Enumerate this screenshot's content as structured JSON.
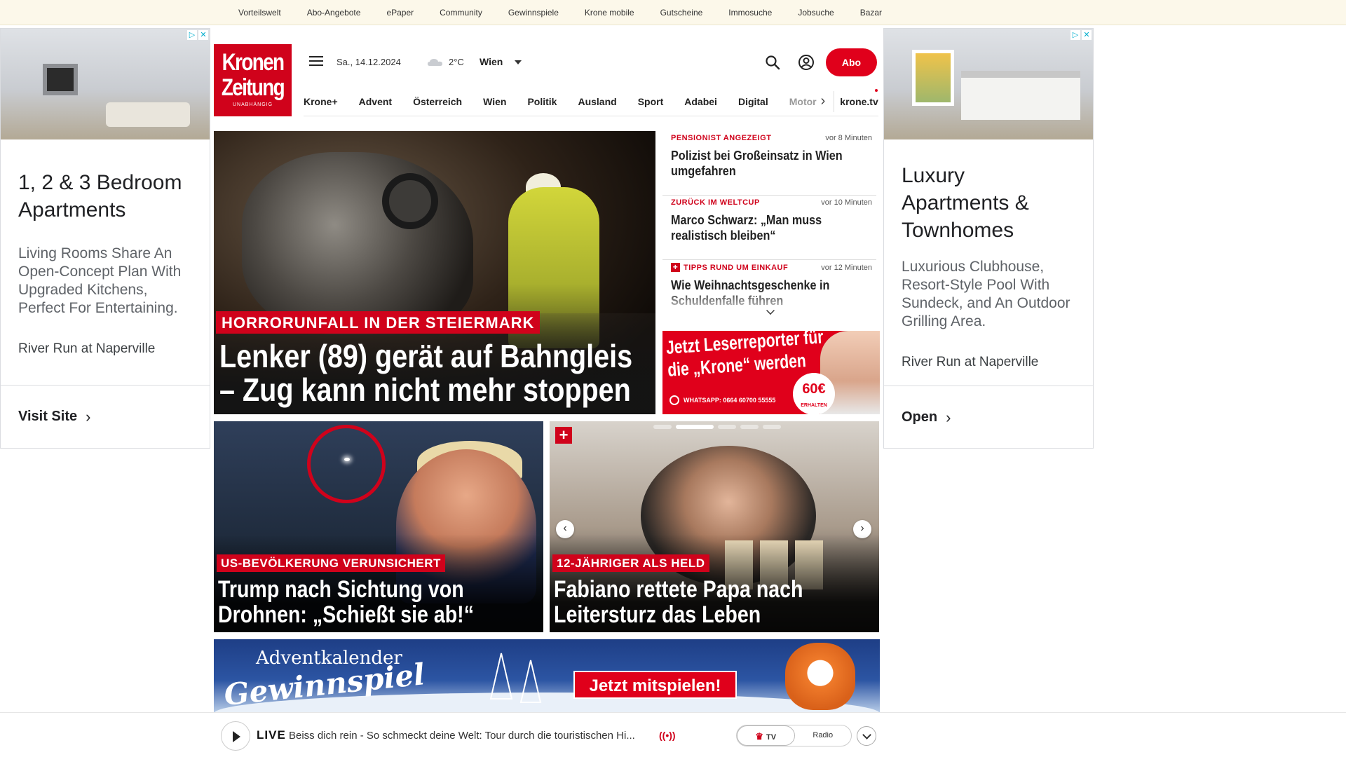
{
  "topbar": {
    "links": [
      "Vorteilswelt",
      "Abo-Angebote",
      "ePaper",
      "Community",
      "Gewinnspiele",
      "Krone mobile",
      "Gutscheine",
      "Immosuche",
      "Jobsuche",
      "Bazar"
    ]
  },
  "ads": {
    "left": {
      "title": "1, 2 & 3 Bedroom Apartments",
      "description": "Living Rooms Share An Open-Concept Plan With Upgraded Kitchens, Perfect For Entertaining.",
      "advertiser": "River Run at Naperville",
      "cta": "Visit Site"
    },
    "right": {
      "title": "Luxury Apartments & Townhomes",
      "description": "Luxurious Clubhouse, Resort-Style Pool With Sundeck, and An Outdoor Grilling Area.",
      "advertiser": "River Run at Naperville",
      "cta": "Open"
    }
  },
  "header": {
    "logo_line1": "Kronen",
    "logo_line2": "Zeitung",
    "logo_tagline": "UNABHÄNGIG",
    "date": "Sa., 14.12.2024",
    "temperature": "2°C",
    "city": "Wien",
    "abo_label": "Abo"
  },
  "nav": {
    "items": [
      "Krone+",
      "Advent",
      "Österreich",
      "Wien",
      "Politik",
      "Ausland",
      "Sport",
      "Adabei",
      "Digital",
      "Motor"
    ],
    "tv_label": "krone.tv"
  },
  "hero": {
    "kicker": "HORRORUNFALL IN DER STEIERMARK",
    "title": "Lenker (89) gerät auf Bahngleis – Zug kann nicht mehr stoppen"
  },
  "news": [
    {
      "kicker": "PENSIONIST ANGEZEIGT",
      "time": "vor 8 Minuten",
      "headline": "Polizist bei Großeinsatz in Wien umgefahren",
      "plus": false
    },
    {
      "kicker": "ZURÜCK IM WELTCUP",
      "time": "vor 10 Minuten",
      "headline": "Marco Schwarz: „Man muss realistisch bleiben“",
      "plus": false
    },
    {
      "kicker": "TIPPS RUND UM EINKAUF",
      "time": "vor 12 Minuten",
      "headline": "Wie Weihnachtsgeschenke in Schuldenfalle führen",
      "plus": true
    }
  ],
  "promo": {
    "title": "Jetzt Leserreporter für die „Krone“ werden",
    "whatsapp": "WHATSAPP: 0664 60700 55555",
    "amount": "60€",
    "amount_sub": "ERHALTEN"
  },
  "tiles": {
    "left": {
      "kicker": "US-BEVÖLKERUNG VERUNSICHERT",
      "title": "Trump nach Sichtung von Drohnen: „Schießt sie ab!“"
    },
    "right": {
      "kicker": "12-JÄHRIGER ALS HELD",
      "title": "Fabiano rettete Papa nach Leitersturz das Leben",
      "plus": "+"
    }
  },
  "advent": {
    "line1": "Adventkalender",
    "line2": "Gewinnspiel",
    "cta": "Jetzt mitspielen!"
  },
  "player": {
    "live": "LIVE",
    "text": "Beiss dich rein - So schmeckt deine Welt: Tour durch die touristischen Hi...",
    "tab_tv": "TV",
    "tab_radio": "Radio"
  }
}
